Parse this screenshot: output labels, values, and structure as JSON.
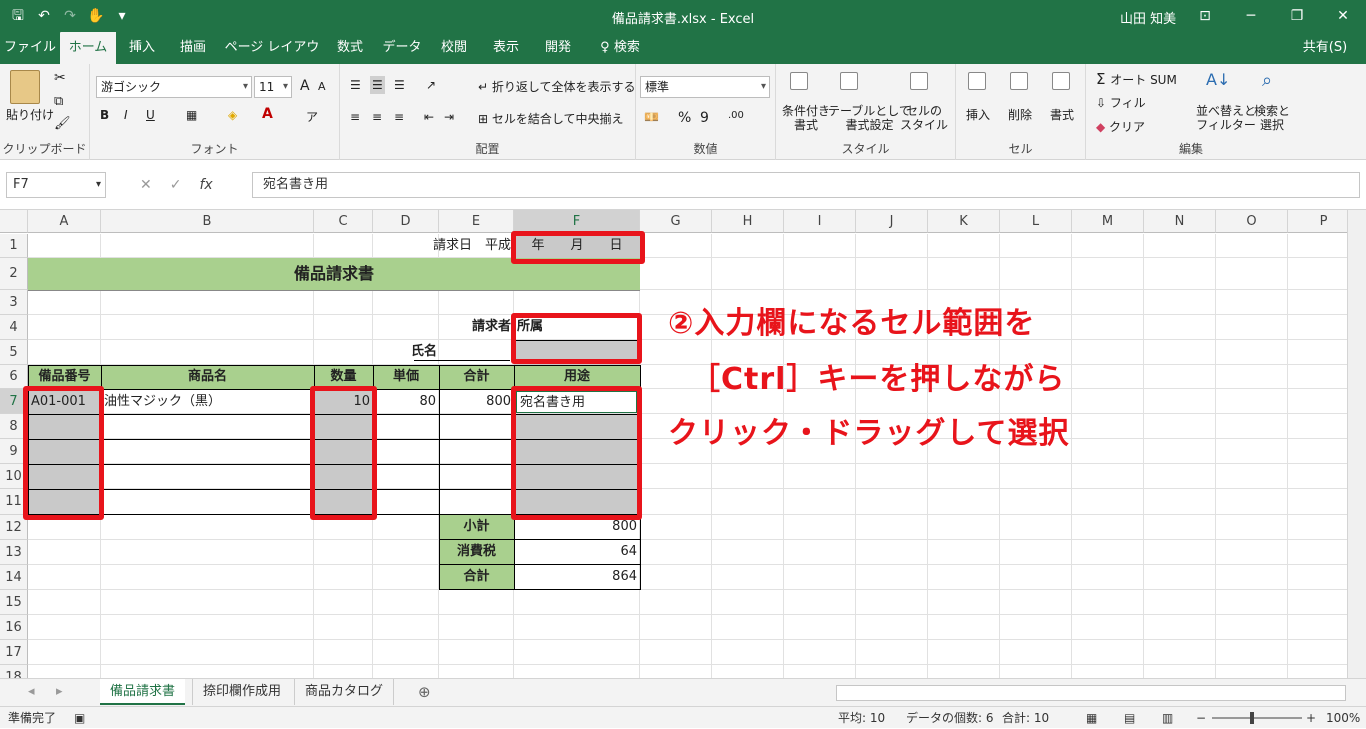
{
  "window": {
    "title": "備品請求書.xlsx  -  Excel",
    "user": "山田 知美",
    "controls": [
      "⊡",
      "─",
      "❐",
      "✕"
    ]
  },
  "qat": {
    "icons": [
      "save-icon",
      "undo-icon",
      "redo-icon",
      "touch-mode-icon",
      "customize-icon"
    ]
  },
  "tabs": [
    {
      "label": "ファイル"
    },
    {
      "label": "ホーム"
    },
    {
      "label": "挿入"
    },
    {
      "label": "描画"
    },
    {
      "label": "ページ レイアウト"
    },
    {
      "label": "数式"
    },
    {
      "label": "データ"
    },
    {
      "label": "校閲"
    },
    {
      "label": "表示"
    },
    {
      "label": "開発"
    },
    {
      "label": "♀ 検索"
    }
  ],
  "share": "共有(S)",
  "ribbon": {
    "clipboard": {
      "paste": "貼り付け",
      "group": "クリップボード"
    },
    "font": {
      "name": "游ゴシック",
      "size": "11",
      "grow": "A",
      "shrink": "A",
      "bold": "B",
      "italic": "I",
      "underline": "U",
      "group": "フォント"
    },
    "align": {
      "wrap": "折り返して全体を表示する",
      "merge": "セルを結合して中央揃え",
      "group": "配置"
    },
    "number": {
      "format": "標準",
      "percent": "%",
      "comma": "9",
      "group": "数値"
    },
    "style": {
      "cond": "条件付き\n書式",
      "table": "テーブルとして\n書式設定",
      "cell": "セルの\nスタイル",
      "group": "スタイル"
    },
    "cells": {
      "insert": "挿入",
      "delete": "削除",
      "format": "書式",
      "group": "セル"
    },
    "edit": {
      "autosum": "オート SUM",
      "fill": "フィル",
      "clear": "クリア",
      "sort": "並べ替えと\nフィルター",
      "find": "検索と\n選択",
      "group": "編集"
    }
  },
  "formula_bar": {
    "name_box": "F7",
    "cancel": "✕",
    "enter": "✓",
    "fx": "fx",
    "content": "宛名書き用"
  },
  "columns": [
    "A",
    "B",
    "C",
    "D",
    "E",
    "F",
    "G",
    "H",
    "I",
    "J",
    "K",
    "L",
    "M",
    "N",
    "O",
    "P"
  ],
  "rows": [
    "1",
    "2",
    "3",
    "4",
    "5",
    "6",
    "7",
    "8",
    "9",
    "10",
    "11",
    "12",
    "13",
    "14",
    "15",
    "16",
    "17",
    "18"
  ],
  "cells": {
    "D1": "請求日　平成",
    "F1": "年　　月　　日",
    "title": "備品請求書",
    "E4": "請求者",
    "F4": "所属",
    "D5": "氏名",
    "A6": "備品番号",
    "B6": "商品名",
    "C6": "数量",
    "D6": "単価",
    "E6": "合計",
    "F6": "用途",
    "A7": "A01-001",
    "B7": "油性マジック（黒）",
    "C7": "10",
    "D7": "80",
    "E7": "800",
    "F7": "宛名書き用",
    "E12": "小計",
    "F12": "800",
    "E13": "消費税",
    "F13": "64",
    "E14": "合計",
    "F14": "864"
  },
  "annotation": {
    "line1": "②入力欄になるセル範囲を",
    "line2": "［Ctrl］キーを押しながら",
    "line3": "クリック・ドラッグして選択"
  },
  "sheet_tabs": [
    "備品請求書",
    "捺印欄作成用",
    "商品カタログ"
  ],
  "status": {
    "ready": "準備完了",
    "average": "平均: 10",
    "count": "データの個数: 6",
    "sum": "合計: 10",
    "zoom": "100%"
  }
}
